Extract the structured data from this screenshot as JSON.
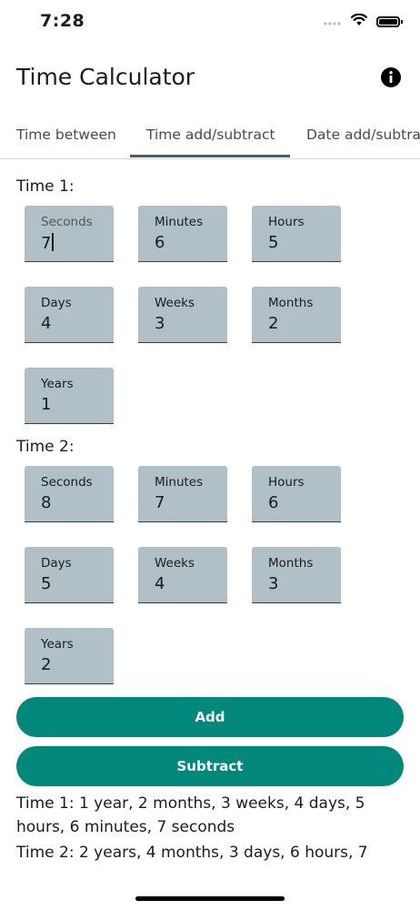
{
  "status_bar": {
    "time": "7:28"
  },
  "app_bar": {
    "title": "Time Calculator",
    "info_icon": "info-icon"
  },
  "tabs": [
    {
      "label": "Time between"
    },
    {
      "label": "Time add/subtract"
    },
    {
      "label": "Date add/subtract"
    }
  ],
  "time1": {
    "label": "Time 1:",
    "fields": {
      "seconds": {
        "label": "Seconds",
        "value": "7"
      },
      "minutes": {
        "label": "Minutes",
        "value": "6"
      },
      "hours": {
        "label": "Hours",
        "value": "5"
      },
      "days": {
        "label": "Days",
        "value": "4"
      },
      "weeks": {
        "label": "Weeks",
        "value": "3"
      },
      "months": {
        "label": "Months",
        "value": "2"
      },
      "years": {
        "label": "Years",
        "value": "1"
      }
    }
  },
  "time2": {
    "label": "Time 2:",
    "fields": {
      "seconds": {
        "label": "Seconds",
        "value": "8"
      },
      "minutes": {
        "label": "Minutes",
        "value": "7"
      },
      "hours": {
        "label": "Hours",
        "value": "6"
      },
      "days": {
        "label": "Days",
        "value": "5"
      },
      "weeks": {
        "label": "Weeks",
        "value": "4"
      },
      "months": {
        "label": "Months",
        "value": "3"
      },
      "years": {
        "label": "Years",
        "value": "2"
      }
    }
  },
  "actions": {
    "add_label": "Add",
    "subtract_label": "Subtract"
  },
  "results": {
    "time1_text": "Time 1: 1 year, 2 months, 3 weeks, 4 days, 5 hours, 6 minutes, 7 seconds",
    "time2_text": "Time 2: 2 years, 4 months, 3 days, 6 hours, 7"
  },
  "colors": {
    "accent": "#00897b",
    "field_bg": "#b1bfc6",
    "tab_indicator": "#4e5a66"
  }
}
